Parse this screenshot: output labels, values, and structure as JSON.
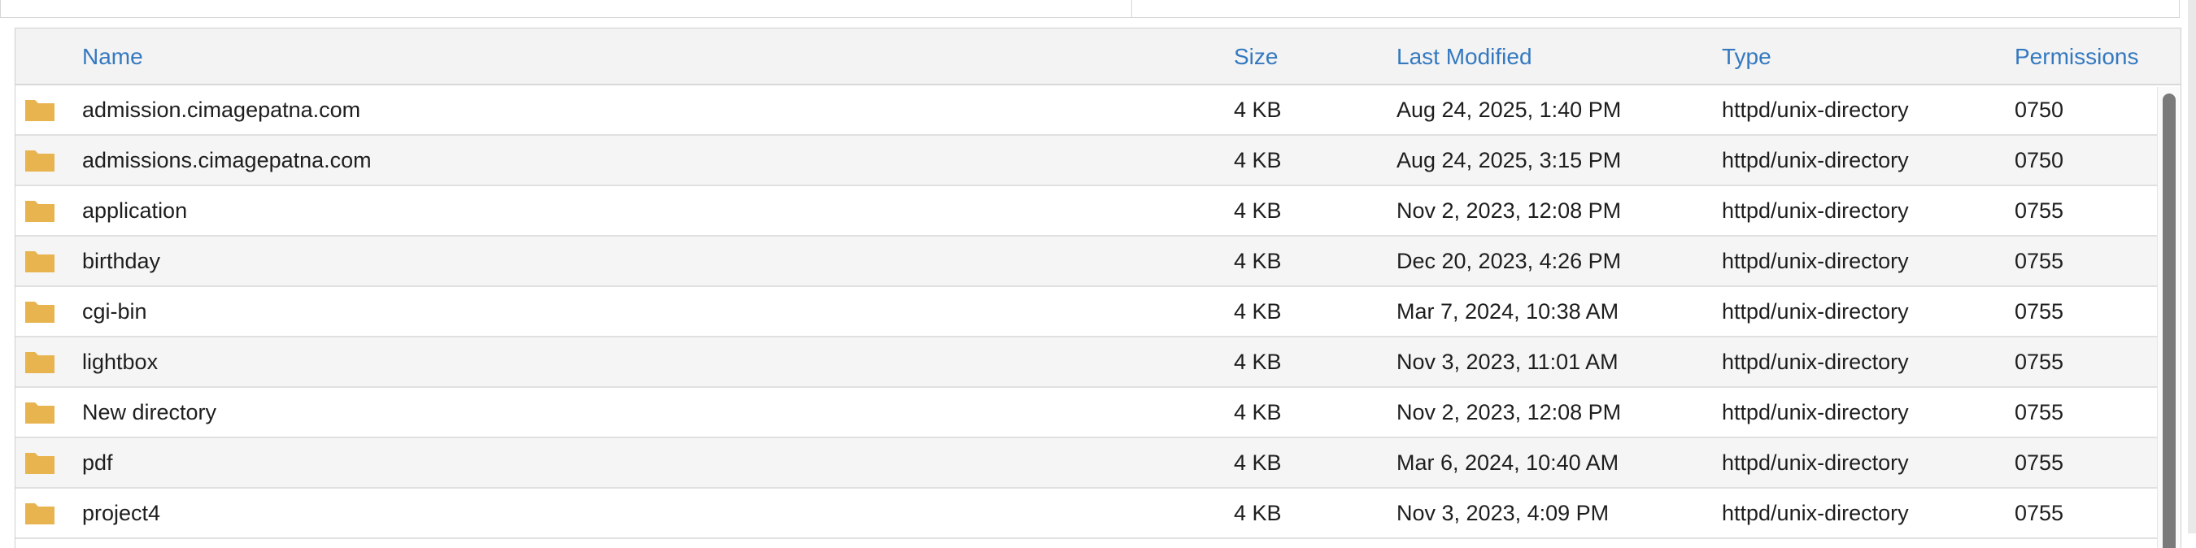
{
  "table": {
    "columns": {
      "name": "Name",
      "size": "Size",
      "last_modified": "Last Modified",
      "type": "Type",
      "permissions": "Permissions"
    },
    "rows": [
      {
        "name": "admission.cimagepatna.com",
        "size": "4 KB",
        "modified": "Aug 24, 2025, 1:40 PM",
        "type": "httpd/unix-directory",
        "perms": "0750",
        "icon": "folder-icon"
      },
      {
        "name": "admissions.cimagepatna.com",
        "size": "4 KB",
        "modified": "Aug 24, 2025, 3:15 PM",
        "type": "httpd/unix-directory",
        "perms": "0750",
        "icon": "folder-icon"
      },
      {
        "name": "application",
        "size": "4 KB",
        "modified": "Nov 2, 2023, 12:08 PM",
        "type": "httpd/unix-directory",
        "perms": "0755",
        "icon": "folder-icon"
      },
      {
        "name": "birthday",
        "size": "4 KB",
        "modified": "Dec 20, 2023, 4:26 PM",
        "type": "httpd/unix-directory",
        "perms": "0755",
        "icon": "folder-icon"
      },
      {
        "name": "cgi-bin",
        "size": "4 KB",
        "modified": "Mar 7, 2024, 10:38 AM",
        "type": "httpd/unix-directory",
        "perms": "0755",
        "icon": "folder-icon"
      },
      {
        "name": "lightbox",
        "size": "4 KB",
        "modified": "Nov 3, 2023, 11:01 AM",
        "type": "httpd/unix-directory",
        "perms": "0755",
        "icon": "folder-icon"
      },
      {
        "name": "New directory",
        "size": "4 KB",
        "modified": "Nov 2, 2023, 12:08 PM",
        "type": "httpd/unix-directory",
        "perms": "0755",
        "icon": "folder-icon"
      },
      {
        "name": "pdf",
        "size": "4 KB",
        "modified": "Mar 6, 2024, 10:40 AM",
        "type": "httpd/unix-directory",
        "perms": "0755",
        "icon": "folder-icon"
      },
      {
        "name": "project4",
        "size": "4 KB",
        "modified": "Nov 3, 2023, 4:09 PM",
        "type": "httpd/unix-directory",
        "perms": "0755",
        "icon": "folder-icon"
      }
    ]
  },
  "colors": {
    "header_text": "#3479c0",
    "folder": "#e8b44f",
    "row_alt": "#f5f5f5",
    "header_bg": "#f3f3f3"
  }
}
